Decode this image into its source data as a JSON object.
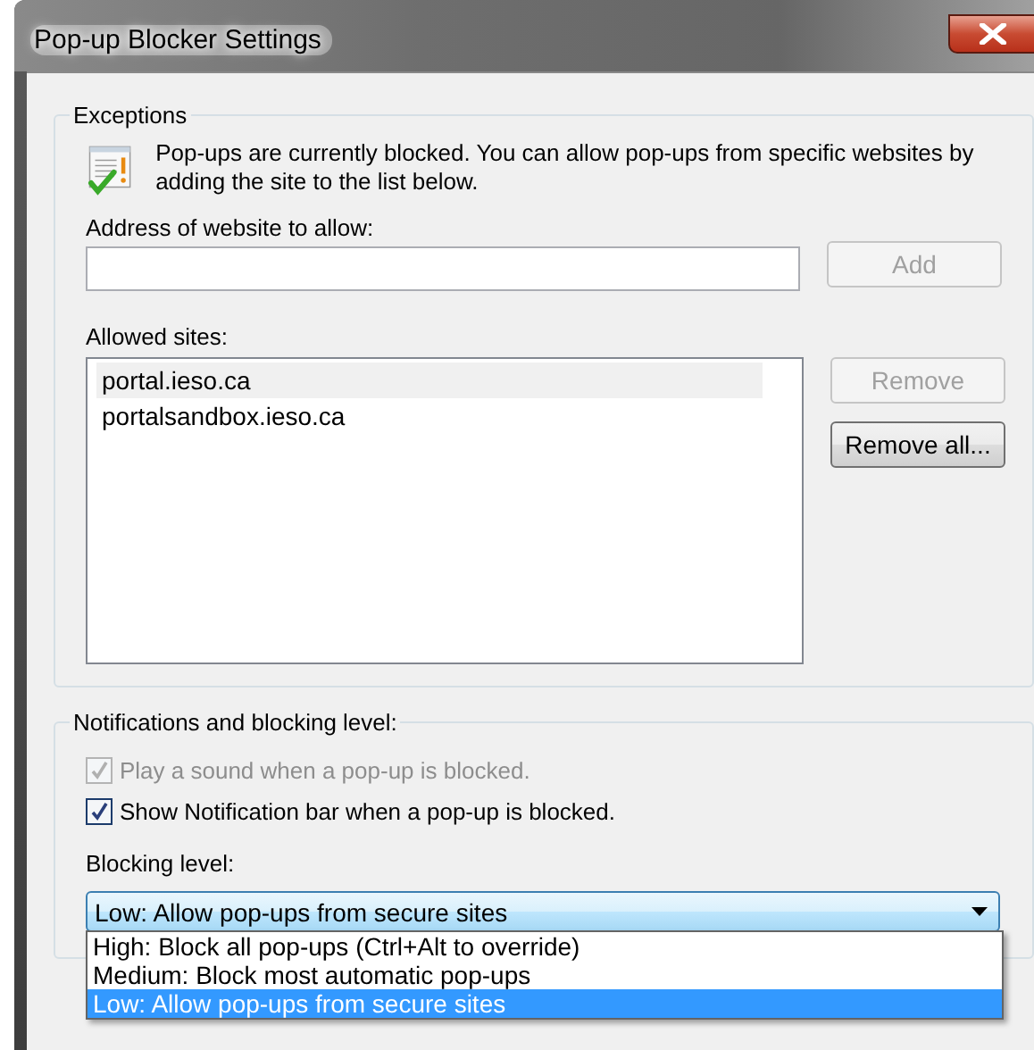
{
  "window": {
    "title": "Pop-up Blocker Settings"
  },
  "exceptions": {
    "heading": "Exceptions",
    "message": "Pop-ups are currently blocked.  You can allow pop-ups from specific websites by adding the site to the list below.",
    "address_label": "Address of website to allow:",
    "add_button": {
      "label": "Add",
      "disabled": true
    },
    "allowed_label": "Allowed sites:",
    "sites": [
      {
        "label": "portal.ieso.ca",
        "selected": true
      },
      {
        "label": "portalsandbox.ieso.ca",
        "selected": false
      }
    ],
    "remove_button": {
      "label": "Remove",
      "disabled": true
    },
    "remove_all_button": {
      "label": "Remove all...",
      "disabled": false
    }
  },
  "notifications": {
    "heading": "Notifications and blocking level:",
    "options": [
      {
        "label": "Play a sound when a pop-up is blocked.",
        "checked": true,
        "disabled": true
      },
      {
        "label": "Show Notification bar when a pop-up is blocked.",
        "checked": true,
        "disabled": false
      }
    ],
    "blocking_label": "Blocking level:",
    "blocking_level": {
      "value": "Low: Allow pop-ups from secure sites",
      "expanded": true,
      "options": [
        {
          "label": "High: Block all pop-ups (Ctrl+Alt to override)",
          "selected": false
        },
        {
          "label": "Medium: Block most automatic pop-ups",
          "selected": false
        },
        {
          "label": "Low: Allow pop-ups from secure sites",
          "selected": true
        }
      ]
    }
  }
}
